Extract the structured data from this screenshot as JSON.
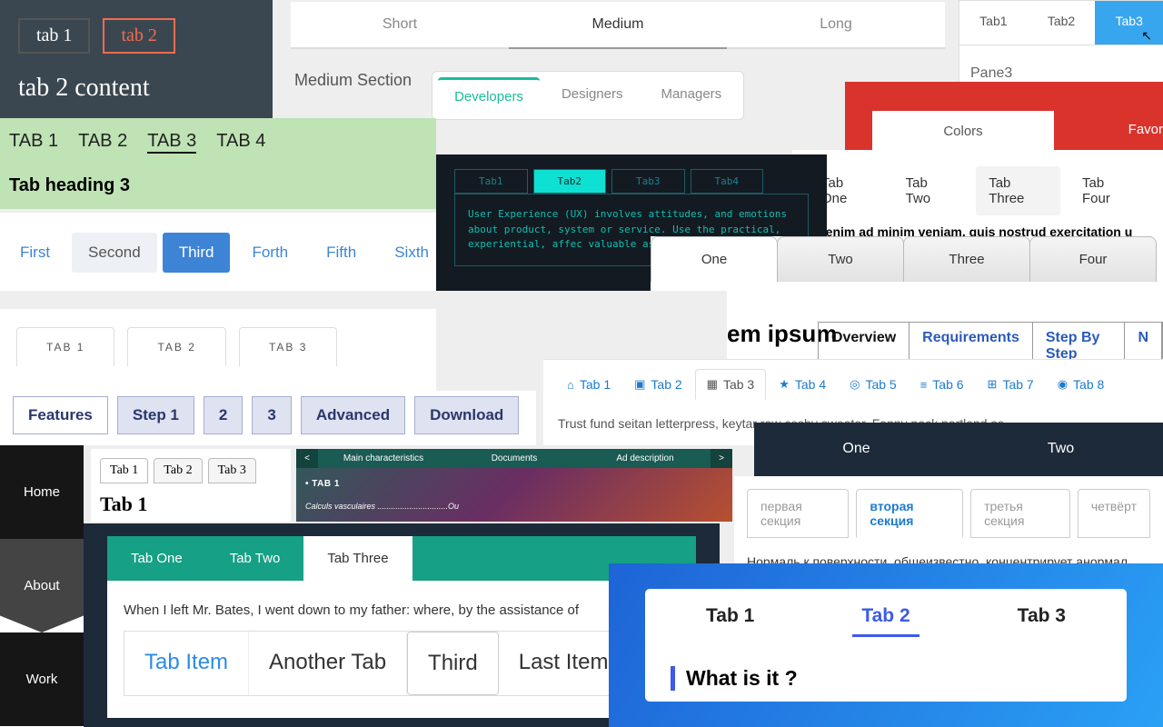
{
  "pA": {
    "tabs": [
      "tab 1",
      "tab 2"
    ],
    "content": "tab 2 content"
  },
  "pB": {
    "tabs": [
      "Short",
      "Medium",
      "Long"
    ],
    "section": "Medium Section",
    "sub": [
      "Developers",
      "Designers",
      "Managers"
    ]
  },
  "pC": {
    "tabs": [
      "Tab1",
      "Tab2",
      "Tab3"
    ],
    "pane": "Pane3"
  },
  "pD": {
    "tabs": [
      "TAB 1",
      "TAB 2",
      "TAB 3",
      "TAB 4"
    ],
    "heading": "Tab heading 3"
  },
  "pE": {
    "left": "Colors",
    "right": "Favor"
  },
  "pF": {
    "tabs": [
      "Tab One",
      "Tab Two",
      "Tab Three",
      "Tab Four"
    ],
    "content": "Ut enim ad minim veniam, quis nostrud exercitation u"
  },
  "pG": {
    "tabs": [
      "First",
      "Second",
      "Third",
      "Forth",
      "Fifth",
      "Sixth"
    ]
  },
  "pH": {
    "tabs": [
      "Tab1",
      "Tab2",
      "Tab3",
      "Tab4"
    ],
    "content": "User Experience (UX) involves attitudes, and emotions about product, system or service. Use the practical, experiential, affec valuable aspects of human-com"
  },
  "pI": {
    "tabs": [
      "One",
      "Two",
      "Three",
      "Four"
    ]
  },
  "pJ": {
    "title": "em ipsum",
    "tabs": [
      "Overview",
      "Requirements",
      "Step By Step",
      "N"
    ]
  },
  "pK": {
    "tabs": [
      "TAB 1",
      "TAB 2",
      "TAB 3"
    ]
  },
  "pL": {
    "tabs": [
      {
        "icon": "⌂",
        "label": "Tab 1"
      },
      {
        "icon": "▣",
        "label": "Tab 2"
      },
      {
        "icon": "▦",
        "label": "Tab 3"
      },
      {
        "icon": "★",
        "label": "Tab 4"
      },
      {
        "icon": "◎",
        "label": "Tab 5"
      },
      {
        "icon": "≡",
        "label": "Tab 6"
      },
      {
        "icon": "⊞",
        "label": "Tab 7"
      },
      {
        "icon": "◉",
        "label": "Tab 8"
      }
    ],
    "content": "Trust fund seitan letterpress, keytar raw cosby sweater. Fanny pack portland se"
  },
  "pM": {
    "tabs": [
      "Features",
      "Step 1",
      "2",
      "3",
      "Advanced",
      "Download"
    ]
  },
  "pN": {
    "tabs": [
      "One",
      "Two"
    ]
  },
  "pO": {
    "tabs": [
      "Home",
      "About",
      "Work"
    ]
  },
  "pP": {
    "tabs": [
      "Tab 1",
      "Tab 2",
      "Tab 3"
    ],
    "heading": "Tab 1"
  },
  "pQ": {
    "tabs": [
      "Main characteristics",
      "Documents",
      "Ad description"
    ],
    "sub": "• TAB 1",
    "row": "Calculs vasculaires ...............................Ou"
  },
  "pR": {
    "tabs": [
      "первая секция",
      "вторая секция",
      "третья секция",
      "четвёрт"
    ],
    "content": "Нормаль к поверхности, общеизвестно, концентрирует анормал"
  },
  "pS": {
    "tabs": [
      "Tab One",
      "Tab Two",
      "Tab Three"
    ],
    "body": "When I left Mr. Bates, I went down to my father: where, by the assistance of ",
    "inner": [
      "Tab Item",
      "Another Tab",
      "Third",
      "Last Item"
    ]
  },
  "pT": {
    "tabs": [
      "Tab 1",
      "Tab 2",
      "Tab 3"
    ],
    "q": "What is it ?"
  }
}
